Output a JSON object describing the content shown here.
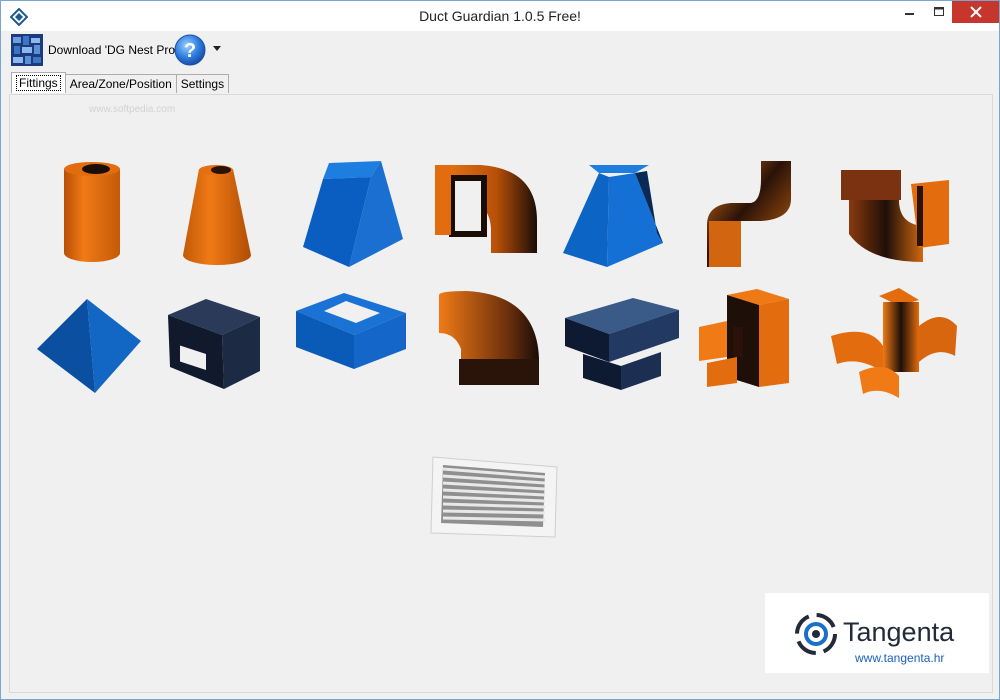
{
  "window": {
    "title": "Duct Guardian 1.0.5  Free!",
    "app_icon": "diamond-arrows-icon",
    "controls": [
      "minimize-icon",
      "maximize-icon",
      "close-icon"
    ]
  },
  "toolbar": {
    "download_label": "Download 'DG Nest Pro'",
    "download_icon": "dg-nest-pro-icon",
    "help_icon": "help-question-icon"
  },
  "tabs": [
    {
      "label": "Fittings",
      "active": true
    },
    {
      "label": "Area/Zone/Position",
      "active": false
    },
    {
      "label": "Settings",
      "active": false
    }
  ],
  "watermark": "www.softpedia.com",
  "fittings": [
    {
      "name": "round-duct-icon",
      "color": "#e06a0c"
    },
    {
      "name": "round-reducer-icon",
      "color": "#e06a0c"
    },
    {
      "name": "rectangular-pyramid-reducer-icon",
      "color": "#0c64c4"
    },
    {
      "name": "rectangular-elbow-with-square-icon",
      "color": "#e06a0c"
    },
    {
      "name": "triangular-transition-icon",
      "color": "#0c64c4"
    },
    {
      "name": "s-offset-icon",
      "color": "#b85a10"
    },
    {
      "name": "elbow-branch-icon",
      "color": "#8b3a0c"
    },
    {
      "name": "pyramid-cap-icon",
      "color": "#0c52a8"
    },
    {
      "name": "rectangular-box-duct-icon",
      "color": "#1b2a4a"
    },
    {
      "name": "square-frame-icon",
      "color": "#0c64c4"
    },
    {
      "name": "rectangular-bend-icon",
      "color": "#e06a0c"
    },
    {
      "name": "rectangular-tee-icon",
      "color": "#1b2a4a"
    },
    {
      "name": "rectangular-cross-icon",
      "color": "#e06a0c"
    },
    {
      "name": "round-cross-icon",
      "color": "#e06a0c"
    },
    {
      "name": "air-grille-icon",
      "color": "#d8d8d8"
    }
  ],
  "logo": {
    "name": "Tangenta",
    "url": "www.tangenta.hr",
    "mark": "tangenta-logo-icon",
    "text_color": "#232a38",
    "url_color": "#1b5fbf"
  }
}
